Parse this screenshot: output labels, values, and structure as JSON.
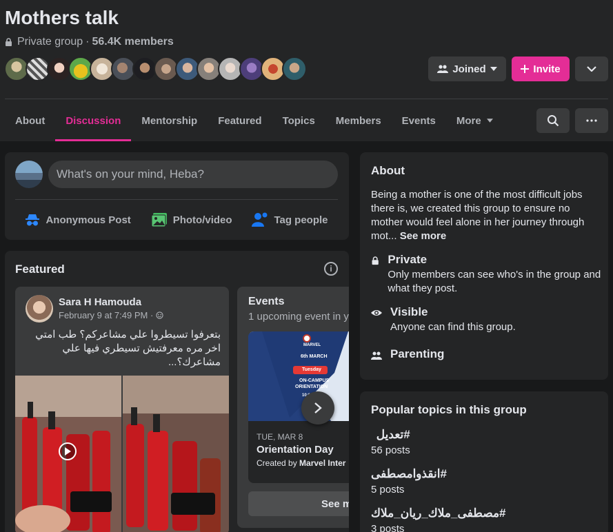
{
  "group": {
    "title": "Mothers talk",
    "privacy": "Private group",
    "separator": "·",
    "members": "56.4K members"
  },
  "header_buttons": {
    "joined": "Joined",
    "invite": "Invite"
  },
  "tabs": [
    {
      "label": "About"
    },
    {
      "label": "Discussion",
      "active": true
    },
    {
      "label": "Mentorship"
    },
    {
      "label": "Featured"
    },
    {
      "label": "Topics"
    },
    {
      "label": "Members"
    },
    {
      "label": "Events"
    },
    {
      "label": "More"
    }
  ],
  "composer": {
    "placeholder": "What's on your mind, Heba?",
    "actions": [
      "Anonymous Post",
      "Photo/video",
      "Tag people"
    ]
  },
  "featured": {
    "title": "Featured",
    "post": {
      "author": "Sara H Hamouda",
      "date": "February 9 at 7:49 PM · ",
      "text": "بتعرفوا تسيطروا علي مشاعركم؟ طب امتي اخر مره معرفتيش تسيطري فيها علي مشاعرك؟..."
    },
    "events": {
      "title": "Events",
      "subtitle": "1 upcoming event in y",
      "poster": {
        "brand": "MARVEL",
        "date": "6th MARCH",
        "day": "Tuesday",
        "line1": "ON-CAMPUS",
        "line2": "ORIENTATION",
        "time": "10:00AM"
      },
      "date": "TUE, MAR 8",
      "name": "Orientation Day",
      "created_prefix": "Created by ",
      "created_by": "Marvel Inter",
      "see_more": "See m"
    }
  },
  "about": {
    "title": "About",
    "description": "Being a mother is one of the most difficult jobs there is, we created this group to ensure no mother would feel alone in her journey through mot... ",
    "see_more": "See more",
    "private_title": "Private",
    "private_desc": "Only members can see who's in the group and what they post.",
    "visible_title": "Visible",
    "visible_desc": "Anyone can find this group.",
    "category": "Parenting"
  },
  "topics": {
    "title": "Popular topics in this group",
    "items": [
      {
        "name": "#تعديل",
        "count": "56 posts"
      },
      {
        "name": "#انقذوامصطفى",
        "count": "5 posts"
      },
      {
        "name": "#مصطفى_ملاك_ريان_ملاك",
        "count": "3 posts"
      }
    ]
  },
  "colors": {
    "accent": "#e42d96",
    "background": "#18191a",
    "card": "#242526",
    "button": "#3a3b3c"
  }
}
